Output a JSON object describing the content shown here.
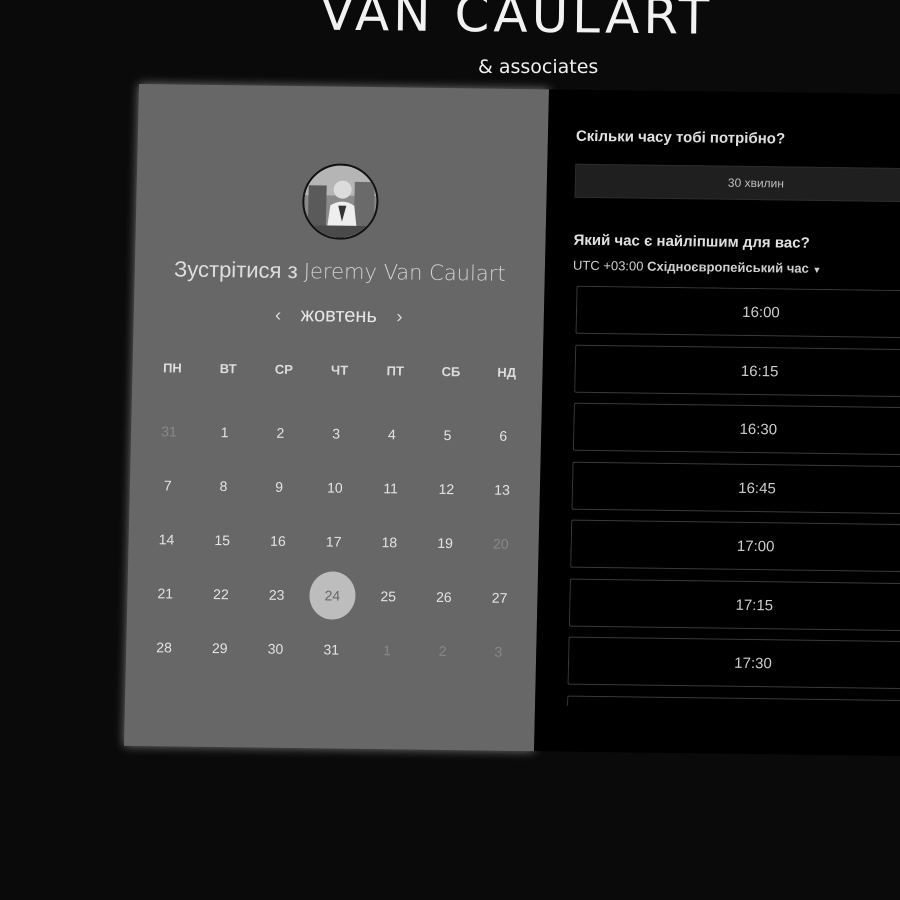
{
  "brand": {
    "title": "VAN CAULART",
    "subtitle": "& associates"
  },
  "host": {
    "prefix": "Зустрітися з ",
    "name": "Jeremy Van Caulart"
  },
  "calendar": {
    "month": "жовтень",
    "prev_icon": "‹",
    "next_icon": "›",
    "weekdays": [
      "ПН",
      "ВТ",
      "СР",
      "ЧТ",
      "ПТ",
      "СБ",
      "НД"
    ],
    "weeks": [
      [
        "31",
        "1",
        "2",
        "3",
        "4",
        "5",
        "6"
      ],
      [
        "7",
        "8",
        "9",
        "10",
        "11",
        "12",
        "13"
      ],
      [
        "14",
        "15",
        "16",
        "17",
        "18",
        "19",
        "20"
      ],
      [
        "21",
        "22",
        "23",
        "24",
        "25",
        "26",
        "27"
      ],
      [
        "28",
        "29",
        "30",
        "31",
        "1",
        "2",
        "3"
      ]
    ],
    "selected": "24"
  },
  "booking": {
    "duration_question": "Скільки часу тобі потрібно?",
    "duration_value": "30 хвилин",
    "time_question": "Який час є найліпшим для вас?",
    "tz_offset": "UTC +03:00",
    "tz_name": "Східноєвропейський час",
    "slots": [
      "16:00",
      "16:15",
      "16:30",
      "16:45",
      "17:00",
      "17:15",
      "17:30",
      ""
    ]
  }
}
